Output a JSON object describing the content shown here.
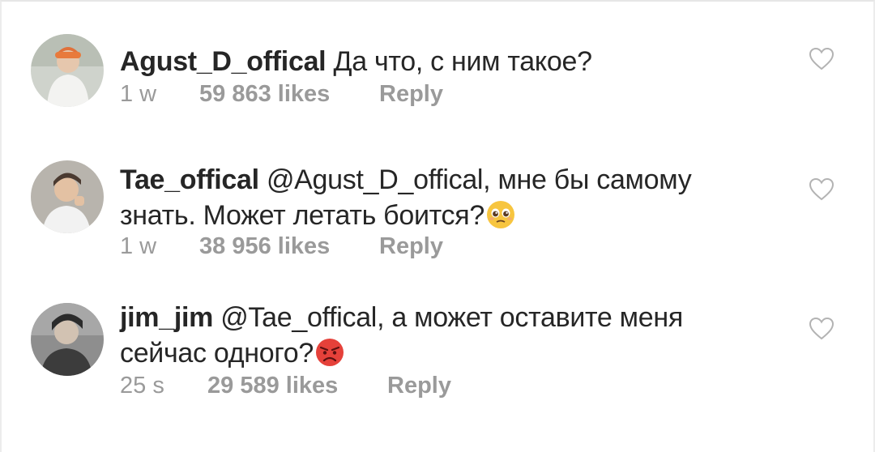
{
  "comments": [
    {
      "username": "Agust_D_offical",
      "text": "Да что, с ним такое?",
      "emoji": "",
      "time": "1 w",
      "likes": "59 863 likes",
      "reply": "Reply",
      "heart_icon": "heart-outline-icon"
    },
    {
      "username": "Tae_offical",
      "text": "@Agust_D_offical, мне бы самому знать. Может летать боится?",
      "emoji": "pleading-face-emoji",
      "time": "1 w",
      "likes": "38 956 likes",
      "reply": "Reply",
      "heart_icon": "heart-outline-icon"
    },
    {
      "username": "jim_jim",
      "text": "@Tae_offical, а может оставите меня сейчас одного?",
      "emoji": "angry-face-emoji",
      "time": "25 s",
      "likes": "29 589 likes",
      "reply": "Reply",
      "heart_icon": "heart-outline-icon"
    }
  ],
  "colors": {
    "text": "#262626",
    "meta": "#9a9a9a",
    "heart": "#b3b3b3",
    "background": "#ffffff"
  }
}
